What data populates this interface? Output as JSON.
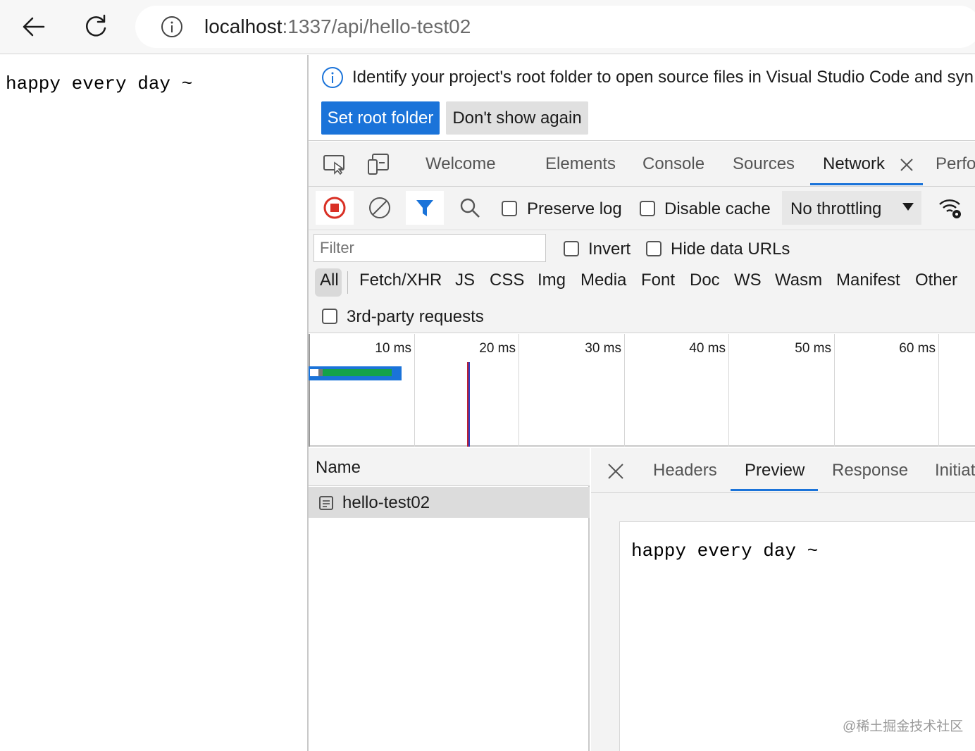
{
  "browser": {
    "url_host": "localhost",
    "url_rest": ":1337/api/hello-test02"
  },
  "page": {
    "body_text": "happy every day ~"
  },
  "devtools": {
    "infobar": {
      "message": "Identify your project's root folder to open source files in Visual Studio Code and syn",
      "set_root_label": "Set root folder",
      "dont_show_label": "Don't show again"
    },
    "tabs": [
      "Welcome",
      "Elements",
      "Console",
      "Sources",
      "Network",
      "Perfo"
    ],
    "toolbar": {
      "preserve_log": "Preserve log",
      "disable_cache": "Disable cache",
      "throttling": "No throttling"
    },
    "filter": {
      "placeholder": "Filter",
      "invert": "Invert",
      "hide_data_urls": "Hide data URLs",
      "types": [
        "All",
        "Fetch/XHR",
        "JS",
        "CSS",
        "Img",
        "Media",
        "Font",
        "Doc",
        "WS",
        "Wasm",
        "Manifest",
        "Other"
      ],
      "third_party": "3rd-party requests"
    },
    "timeline": {
      "ticks": [
        "10 ms",
        "20 ms",
        "30 ms",
        "40 ms",
        "50 ms",
        "60 ms"
      ]
    },
    "requests": {
      "column_name": "Name",
      "rows": [
        {
          "name": "hello-test02"
        }
      ]
    },
    "detail": {
      "tabs": [
        "Headers",
        "Preview",
        "Response",
        "Initiat"
      ],
      "active_tab": "Preview",
      "preview_text": "happy every day ~"
    },
    "colors": {
      "accent": "#1a73d9",
      "record": "#d93025",
      "waterfall_green": "#14a24a"
    }
  },
  "watermark": "@稀土掘金技术社区"
}
